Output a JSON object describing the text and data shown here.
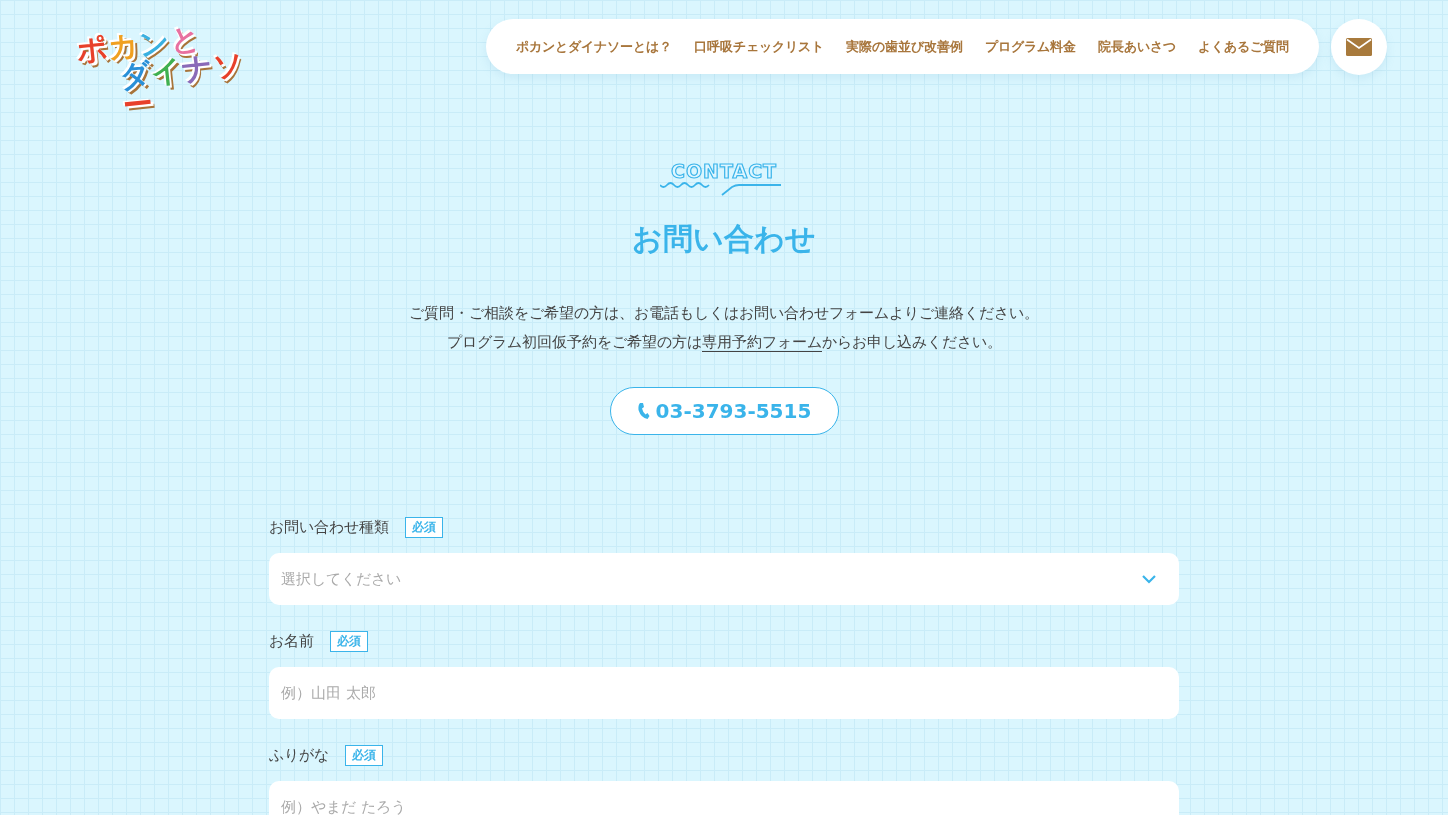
{
  "logo": {
    "line1": "ポカンと",
    "line2": "ダイナソー"
  },
  "nav": {
    "items": [
      "ポカンとダイナソーとは？",
      "口呼吸チェックリスト",
      "実際の歯並び改善例",
      "プログラム料金",
      "院長あいさつ",
      "よくあるご質問"
    ]
  },
  "section": {
    "label": "CONTACT",
    "title": "お問い合わせ"
  },
  "intro": {
    "line1": "ご質問・ご相談をご希望の方は、お電話もしくはお問い合わせフォームよりご連絡ください。",
    "line2_before": "プログラム初回仮予約をご希望の方は",
    "line2_link": "専用予約フォーム",
    "line2_after": "からお申し込みください。"
  },
  "phone": "03-3793-5515",
  "form": {
    "fields": [
      {
        "label": "お問い合わせ種類",
        "badge": "必須",
        "kind": "select",
        "placeholder": "選択してください"
      },
      {
        "label": "お名前",
        "badge": "必須",
        "kind": "text",
        "placeholder": "例）山田 太郎"
      },
      {
        "label": "ふりがな",
        "badge": "必須",
        "kind": "text",
        "placeholder": "例）やまだ たろう"
      }
    ]
  }
}
